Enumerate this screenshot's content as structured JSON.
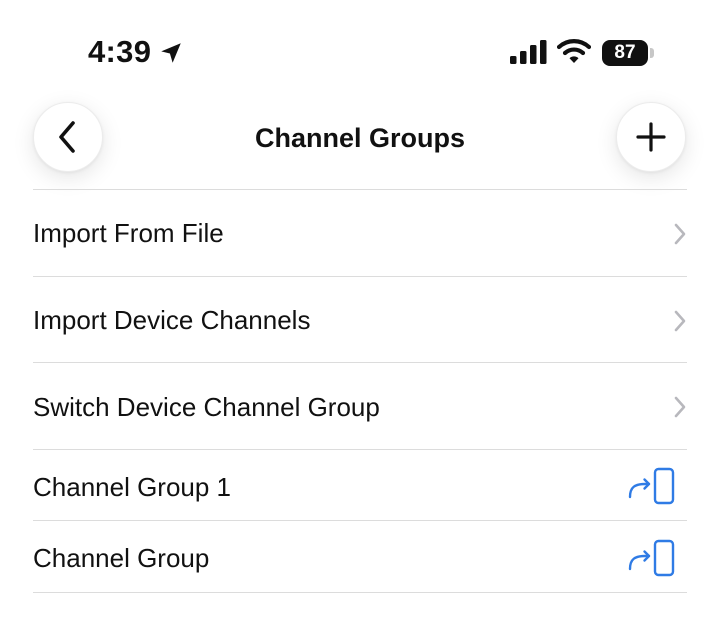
{
  "status_bar": {
    "time": "4:39",
    "battery": "87",
    "icons": [
      "location-arrow-icon",
      "cellular-signal-icon",
      "wifi-icon",
      "battery-icon"
    ]
  },
  "header": {
    "title": "Channel Groups",
    "back_icon": "chevron-left-icon",
    "add_icon": "plus-icon"
  },
  "menu": {
    "items": [
      {
        "label": "Import From File",
        "icon": "chevron-right-icon"
      },
      {
        "label": "Import Device Channels",
        "icon": "chevron-right-icon"
      },
      {
        "label": "Switch Device Channel Group",
        "icon": "chevron-right-icon"
      }
    ]
  },
  "groups": {
    "items": [
      {
        "label": "Channel Group 1",
        "icon": "send-to-device-icon"
      },
      {
        "label": "Channel Group",
        "icon": "send-to-device-icon"
      }
    ]
  },
  "colors": {
    "accent": "#2f7be5",
    "text": "#111111",
    "divider": "#dcdcdc",
    "chevron": "#b8b8bd"
  }
}
